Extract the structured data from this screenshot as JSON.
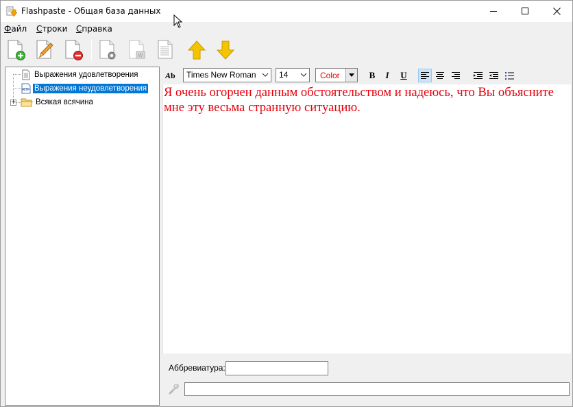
{
  "window": {
    "title": "Flashpaste - Общая база данных"
  },
  "menu": {
    "items": [
      {
        "first": "Ф",
        "rest": "айл"
      },
      {
        "first": "С",
        "rest": "троки"
      },
      {
        "first": "С",
        "rest": "правка"
      }
    ]
  },
  "toolbar": {
    "buttons": [
      "new-item-icon",
      "edit-item-icon",
      "delete-item-icon",
      "settings-doc-icon",
      "word-doc-icon",
      "plain-doc-icon",
      "move-up-icon",
      "move-down-icon"
    ]
  },
  "tree": {
    "items": [
      {
        "label": "Выражения удовлетворения",
        "icon": "text-doc-icon"
      },
      {
        "label": "Выражения неудовлетворения",
        "icon": "rtf-doc-icon",
        "selected": true
      },
      {
        "label": "Всякая всячина",
        "icon": "folder-icon"
      }
    ]
  },
  "format": {
    "font": "Times New Roman",
    "size": "14",
    "color_label": "Color",
    "bold": "B",
    "italic": "I",
    "underline": "U"
  },
  "editor": {
    "text": "Я очень огорчен данным обстоятельством и надеюсь, что Вы объясните мне эту весьма странную ситуацию.",
    "text_color": "#e8000b"
  },
  "abbreviation": {
    "label": "Аббревиатура:",
    "value": ""
  },
  "bottom": {
    "value": ""
  },
  "colors": {
    "selection": "#0078d7",
    "arrow": "#f5c400"
  }
}
